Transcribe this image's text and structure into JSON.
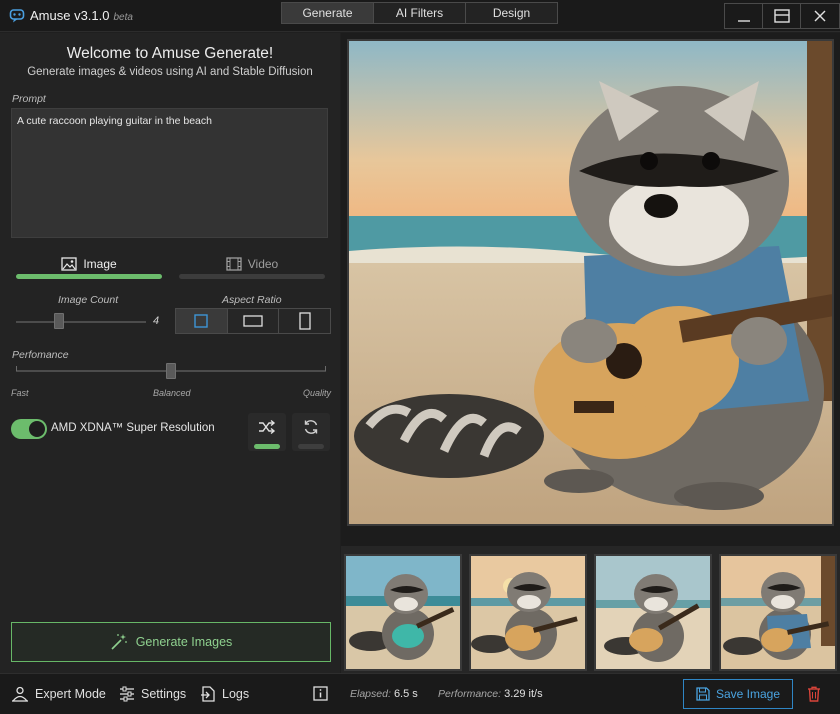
{
  "app": {
    "title": "Amuse v3.1.0",
    "beta": "beta"
  },
  "modes": [
    {
      "label": "Generate",
      "active": true
    },
    {
      "label": "AI Filters",
      "active": false
    },
    {
      "label": "Design",
      "active": false
    }
  ],
  "window_controls": [
    "minimize-icon",
    "maximize-icon",
    "close-icon"
  ],
  "welcome": {
    "title": "Welcome to Amuse Generate!",
    "subtitle": "Generate images & videos using AI and Stable Diffusion"
  },
  "prompt": {
    "label": "Prompt",
    "value": "A cute raccoon playing guitar in the beach"
  },
  "media_tabs": [
    {
      "label": "Image",
      "icon": "image-icon",
      "active": true
    },
    {
      "label": "Video",
      "icon": "film-icon",
      "active": false
    }
  ],
  "image_count": {
    "label": "Image Count",
    "value": "4",
    "slider_fraction": 0.33
  },
  "aspect_ratio": {
    "label": "Aspect Ratio",
    "options": [
      "square-icon",
      "landscape-icon",
      "portrait-icon"
    ],
    "selected": 0
  },
  "performance": {
    "label": "Perfomance",
    "ticks": [
      "Fast",
      "Balanced",
      "Quality"
    ],
    "slider_fraction": 0.5
  },
  "super_resolution": {
    "label": "AMD XDNA™ Super Resolution",
    "enabled": true
  },
  "option_buttons": [
    {
      "icon": "shuffle-icon",
      "active": true
    },
    {
      "icon": "refresh-icon",
      "active": false
    }
  ],
  "generate_button": {
    "label": "Generate Images",
    "icon": "magic-wand-icon"
  },
  "bottom": {
    "expert_mode": "Expert Mode",
    "settings": "Settings",
    "logs": "Logs",
    "elapsed_label": "Elapsed:",
    "elapsed_value": "6.5 s",
    "performance_label": "Performance:",
    "performance_value": "3.29 it/s",
    "save_label": "Save Image"
  },
  "colors": {
    "accent_green": "#6cbc6c",
    "accent_blue": "#2f86c5",
    "delete_red": "#d9443a"
  }
}
